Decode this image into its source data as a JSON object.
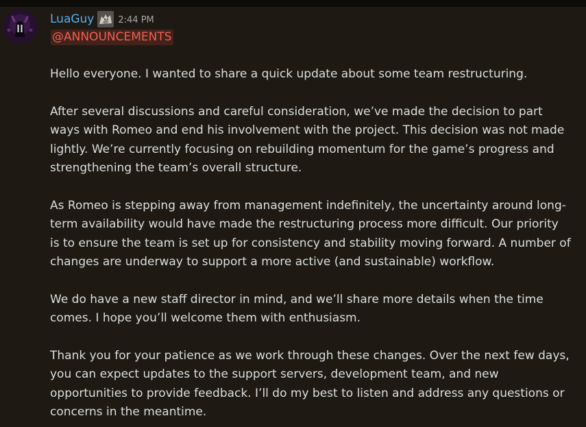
{
  "message": {
    "author": "LuaGuy",
    "timestamp": "2:44 PM",
    "mention": "@ANNOUNCEMENTS",
    "author_color": "#58aef0",
    "avatar_icon": "dark-figure-avatar",
    "role_icon": "wolf-icon",
    "paragraphs": [
      "Hello everyone. I wanted to share a quick update about some team restructuring.",
      "After several discussions and careful consideration, we’ve made the decision to part\nways with Romeo and end his involvement with the project. This decision was not made\nlightly. We’re currently focusing on rebuilding momentum for the game’s progress and\nstrengthening the team’s overall structure.",
      "As Romeo is stepping away from management indefinitely, the uncertainty around long-\nterm availability would have made the restructuring process more difficult. Our priority\nis to ensure the team is set up for consistency and stability moving forward. A number of\nchanges are underway to support a more active (and sustainable) workflow.",
      "We do have a new staff director in mind, and we’ll share more details when the time\ncomes. I hope you’ll welcome them with enthusiasm.",
      "Thank you for your patience as we work through these changes. Over the next few days,\nyou can expect updates to the support servers, development team, and new\nopportunities to provide feedback. I’ll do my best to listen and address any questions or\nconcerns in the meantime."
    ]
  }
}
